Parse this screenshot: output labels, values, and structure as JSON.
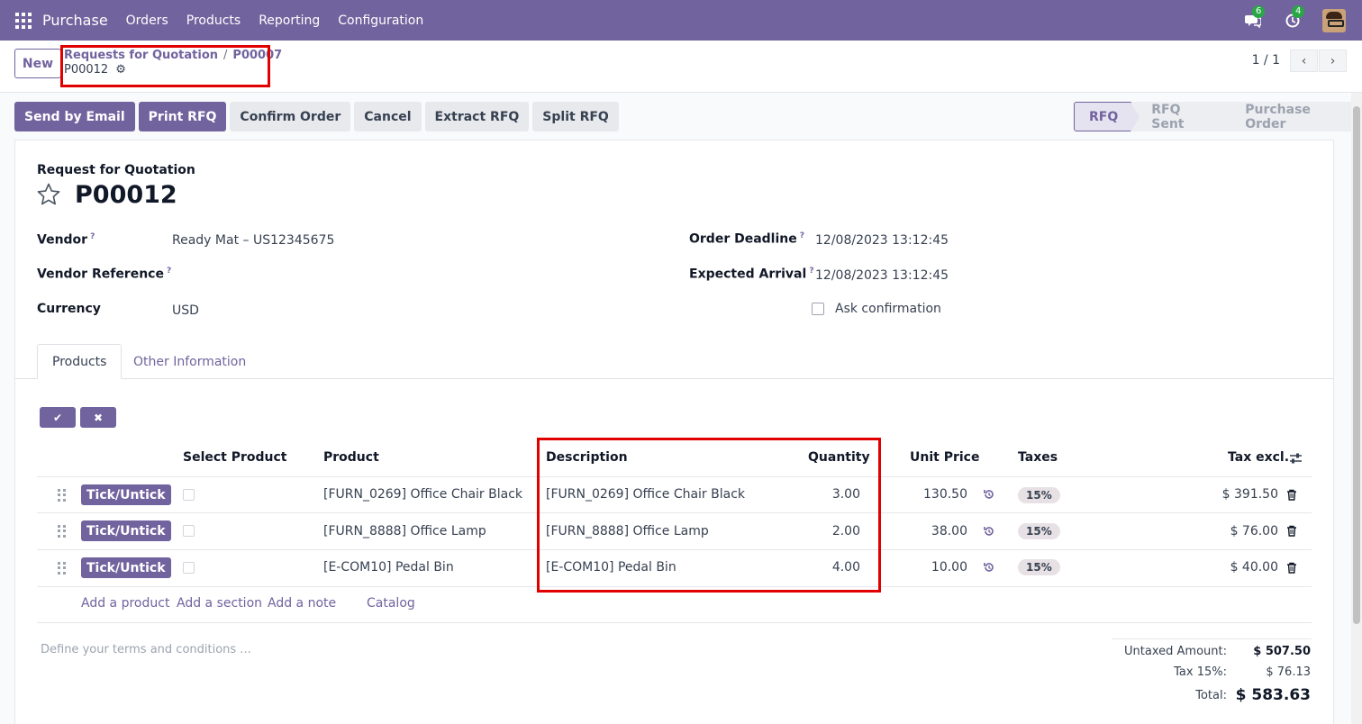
{
  "navbar": {
    "brand": "Purchase",
    "menu": [
      "Orders",
      "Products",
      "Reporting",
      "Configuration"
    ],
    "messages_count": "6",
    "activities_count": "4"
  },
  "control": {
    "new_label": "New",
    "breadcrumb_parent": "Requests for Quotation",
    "breadcrumb_middle": "P00007",
    "breadcrumb_current": "P00012",
    "pager": "1 / 1"
  },
  "actions": {
    "send_email": "Send by Email",
    "print_rfq": "Print RFQ",
    "confirm_order": "Confirm Order",
    "cancel": "Cancel",
    "extract_rfq": "Extract RFQ",
    "split_rfq": "Split RFQ"
  },
  "status": {
    "stage1": "RFQ",
    "stage2": "RFQ Sent",
    "stage3": "Purchase Order"
  },
  "form": {
    "title_label": "Request for Quotation",
    "name": "P00012",
    "vendor_label": "Vendor",
    "vendor_value": "Ready Mat – US12345675",
    "vendor_ref_label": "Vendor Reference",
    "currency_label": "Currency",
    "currency_value": "USD",
    "deadline_label": "Order Deadline",
    "deadline_value": "12/08/2023 13:12:45",
    "arrival_label": "Expected Arrival",
    "arrival_value": "12/08/2023 13:12:45",
    "ask_confirmation": "Ask confirmation",
    "help_mark": "?"
  },
  "tabs": {
    "products": "Products",
    "other": "Other Information"
  },
  "table": {
    "headers": {
      "select": "Select Product",
      "product": "Product",
      "description": "Description",
      "quantity": "Quantity",
      "unit_price": "Unit Price",
      "taxes": "Taxes",
      "tax_excl": "Tax excl."
    },
    "tick_label": "Tick/Untick",
    "rows": [
      {
        "product": "[FURN_0269] Office Chair Black",
        "description": "[FURN_0269] Office Chair Black",
        "quantity": "3.00",
        "unit_price": "130.50",
        "tax": "15%",
        "subtotal": "$ 391.50"
      },
      {
        "product": "[FURN_8888] Office Lamp",
        "description": "[FURN_8888] Office Lamp",
        "quantity": "2.00",
        "unit_price": "38.00",
        "tax": "15%",
        "subtotal": "$ 76.00"
      },
      {
        "product": "[E-COM10] Pedal Bin",
        "description": "[E-COM10] Pedal Bin",
        "quantity": "4.00",
        "unit_price": "10.00",
        "tax": "15%",
        "subtotal": "$ 40.00"
      }
    ],
    "add_product": "Add a product",
    "add_section": "Add a section",
    "add_note": "Add a note",
    "catalog": "Catalog"
  },
  "footer": {
    "terms_placeholder": "Define your terms and conditions ...",
    "untaxed_label": "Untaxed Amount:",
    "untaxed_value": "$ 507.50",
    "tax_label": "Tax 15%:",
    "tax_value": "$ 76.13",
    "total_label": "Total:",
    "total_value": "$ 583.63"
  }
}
